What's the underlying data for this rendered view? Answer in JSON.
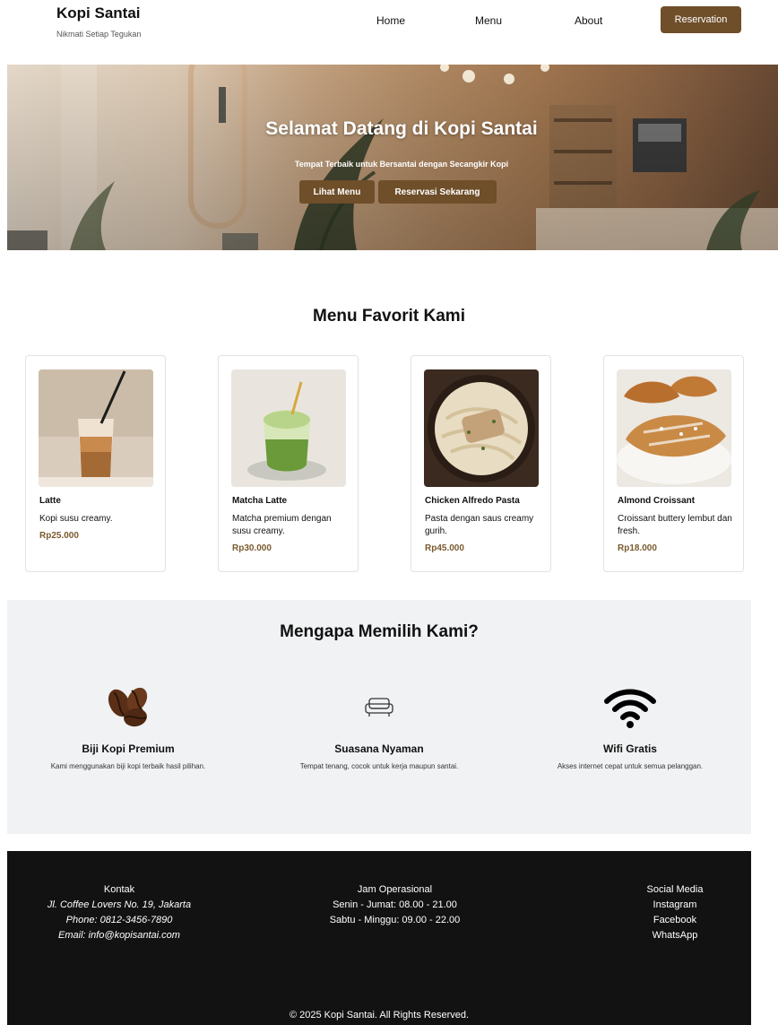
{
  "brand": {
    "title": "Kopi Santai",
    "tagline": "Nikmati Setiap Tegukan"
  },
  "nav": {
    "home": "Home",
    "menu": "Menu",
    "about": "About",
    "reservation": "Reservation"
  },
  "hero": {
    "title": "Selamat Datang di Kopi Santai",
    "subtitle": "Tempat Terbaik untuk Bersantai dengan Secangkir Kopi",
    "btn_menu": "Lihat Menu",
    "btn_reserve": "Reservasi Sekarang"
  },
  "menu_section": {
    "title": "Menu Favorit Kami",
    "items": [
      {
        "name": "Latte",
        "desc": "Kopi susu creamy.",
        "price": "Rp25.000"
      },
      {
        "name": "Matcha Latte",
        "desc": "Matcha premium dengan susu creamy.",
        "price": "Rp30.000"
      },
      {
        "name": "Chicken Alfredo Pasta",
        "desc": "Pasta dengan saus creamy gurih.",
        "price": "Rp45.000"
      },
      {
        "name": "Almond Croissant",
        "desc": "Croissant buttery lembut dan fresh.",
        "price": "Rp18.000"
      }
    ]
  },
  "why_section": {
    "title": "Mengapa Memilih Kami?",
    "features": [
      {
        "icon": "coffee-beans-icon",
        "title": "Biji Kopi Premium",
        "desc": "Kami menggunakan biji kopi terbaik hasil pilihan."
      },
      {
        "icon": "sofa-icon",
        "title": "Suasana Nyaman",
        "desc": "Tempat tenang, cocok untuk kerja maupun santai."
      },
      {
        "icon": "wifi-icon",
        "title": "Wifi Gratis",
        "desc": "Akses internet cepat untuk semua pelanggan."
      }
    ]
  },
  "footer": {
    "contact": {
      "heading": "Kontak",
      "address": "Jl. Coffee Lovers No. 19, Jakarta",
      "phone": "Phone: 0812-3456-7890",
      "email": "Email: info@kopisantai.com"
    },
    "hours": {
      "heading": "Jam Operasional",
      "weekday": "Senin - Jumat: 08.00 - 21.00",
      "weekend": "Sabtu - Minggu: 09.00 - 22.00"
    },
    "social": {
      "heading": "Social Media",
      "links": [
        "Instagram",
        "Facebook",
        "WhatsApp"
      ]
    },
    "copyright": "© 2025 Kopi Santai. All Rights Reserved."
  },
  "colors": {
    "accent": "#6f4e2a",
    "price": "#7a5a2e",
    "footer_bg": "#121212",
    "why_bg": "#f1f2f4"
  }
}
